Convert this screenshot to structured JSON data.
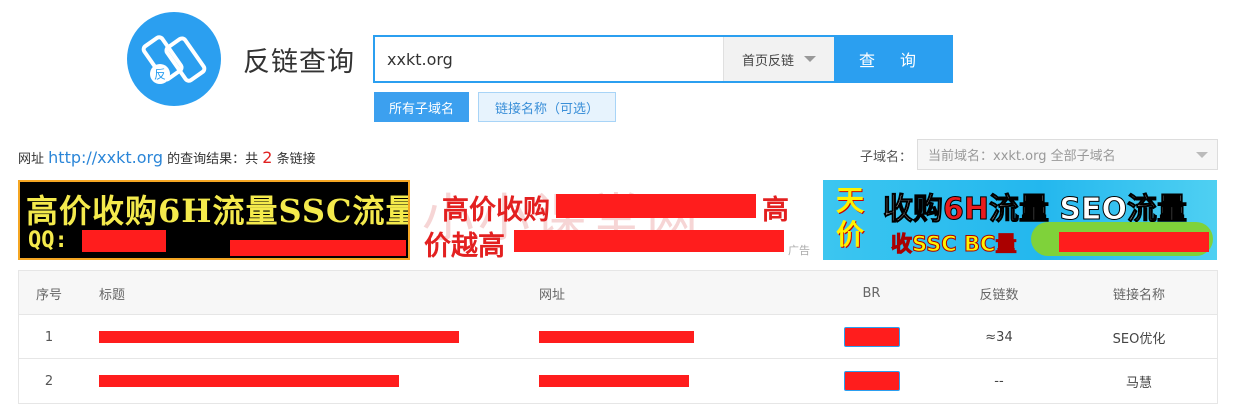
{
  "app": {
    "title": "反链查询",
    "logo_char": "反"
  },
  "search": {
    "value": "xxkt.org",
    "mode": "首页反链",
    "button": "查 询"
  },
  "options": {
    "all_subdomains": "所有子域名",
    "anchor_text": "链接名称（可选）"
  },
  "summary": {
    "prefix": "网址",
    "url": "http://xxkt.org",
    "middle": "的查询结果：共",
    "count": "2",
    "suffix": "条链接"
  },
  "subdomain": {
    "label": "子域名：",
    "value": "当前域名：xxkt.org 全部子域名"
  },
  "ads": {
    "ad1": {
      "line1": "高价收购6H流量SSC流量",
      "line2": "QQ:"
    },
    "ad2": {
      "watermark": "小小课堂网",
      "line1": "高价收购",
      "line1_end": "高",
      "line2": "价越高",
      "tag": "广告"
    },
    "ad3": {
      "tian": "天价",
      "big_pre": "收购",
      "big_hl": "6H",
      "big_post": "流量 SEO流量",
      "small": "收SSC BC量"
    }
  },
  "table": {
    "headers": {
      "index": "序号",
      "title": "标题",
      "url": "网址",
      "br": "BR",
      "backlinks": "反链数",
      "anchor": "链接名称"
    },
    "rows": [
      {
        "index": "1",
        "backlinks": "≈34",
        "anchor": "SEO优化"
      },
      {
        "index": "2",
        "backlinks": "--",
        "anchor": "马慧"
      }
    ]
  },
  "colors": {
    "accent": "#2b9ff0",
    "redaction": "#ff1d1d",
    "count": "#e02020"
  },
  "icons": {
    "logo": "chain-link-icon",
    "mode_caret": "caret-down-icon",
    "subdomain_caret": "caret-down-icon"
  }
}
